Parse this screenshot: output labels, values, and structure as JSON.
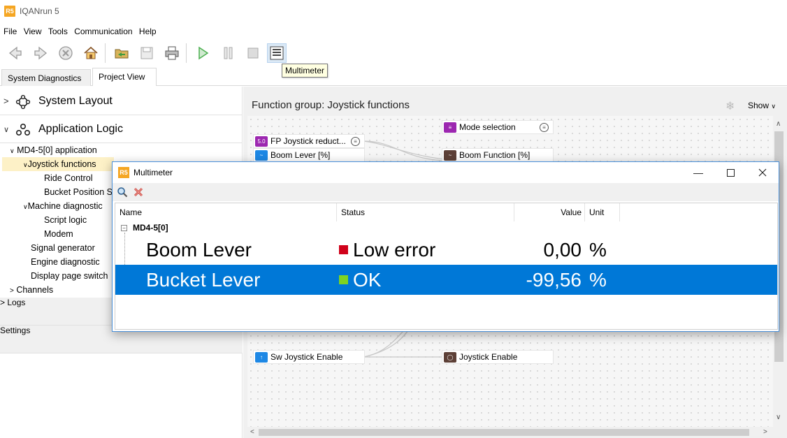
{
  "app": {
    "title": "IQANrun 5",
    "logo": "R5"
  },
  "menu": [
    "File",
    "View",
    "Tools",
    "Communication",
    "Help"
  ],
  "toolbar": {
    "tooltip": "Multimeter",
    "buttons": [
      "back-icon",
      "forward-icon",
      "stop-icon",
      "home-icon",
      "open-folder-icon",
      "save-icon",
      "print-icon",
      "play-icon",
      "pause-icon",
      "record-stop-icon",
      "multimeter-icon"
    ]
  },
  "tabs": [
    {
      "label": "System Diagnostics",
      "selected": false
    },
    {
      "label": "Project View",
      "selected": true
    }
  ],
  "left": {
    "sections": [
      {
        "chevron": ">",
        "label": "System Layout"
      },
      {
        "chevron": "v",
        "label": "Application Logic"
      }
    ],
    "tree": [
      "MD4-5[0] application",
      "Joystick functions",
      "Ride Control",
      "Bucket Position S",
      "Machine diagnostic",
      "Script logic",
      "Modem",
      "Signal generator",
      "Engine diagnostic",
      "Display page switch",
      "Channels"
    ],
    "bottom_sections": [
      {
        "chevron": ">",
        "label": "Logs"
      },
      {
        "chevron": "",
        "label": "Settings"
      }
    ]
  },
  "canvas": {
    "title": "Function group: Joystick functions",
    "show_label": "Show",
    "nodes": [
      {
        "label": "Mode selection",
        "color": "#9c27b0"
      },
      {
        "label": "FP Joystick reduct...",
        "color": "#9c27b0",
        "badge": "5.0"
      },
      {
        "label": "Boom Lever [%]",
        "color": "#1e88e5"
      },
      {
        "label": "Boom Function [%]",
        "color": "#5d4037"
      },
      {
        "label": "Sw Joystick Enable",
        "color": "#1e88e5"
      },
      {
        "label": "Joystick Enable",
        "color": "#5d4037"
      }
    ]
  },
  "multimeter": {
    "title": "Multimeter",
    "columns": {
      "name": "Name",
      "status": "Status",
      "value": "Value",
      "unit": "Unit"
    },
    "group": "MD4-5[0]",
    "rows": [
      {
        "name": "Boom Lever",
        "status": "Low error",
        "status_color": "#d0021b",
        "value": "0,00",
        "unit": "%",
        "selected": false
      },
      {
        "name": "Bucket Lever",
        "status": "OK",
        "status_color": "#7ed321",
        "value": "-99,56",
        "unit": "%",
        "selected": true
      }
    ]
  }
}
